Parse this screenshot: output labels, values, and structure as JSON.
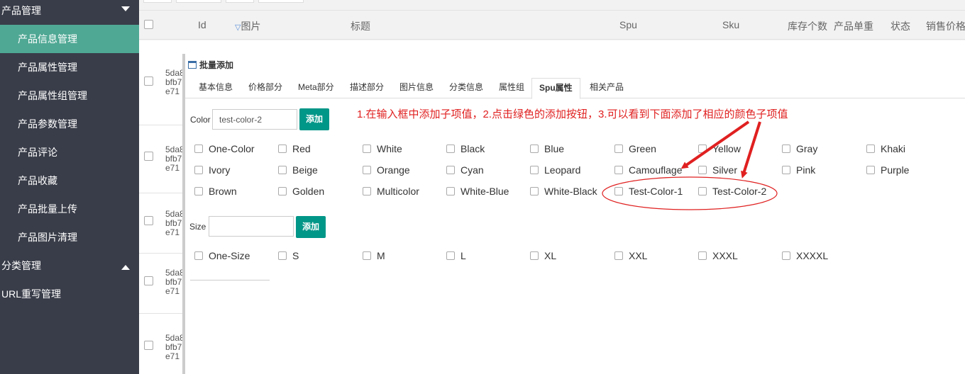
{
  "sidebar": {
    "group_product": "产品管理",
    "items": [
      {
        "label": "产品信息管理",
        "active": true
      },
      {
        "label": "产品属性管理",
        "active": false
      },
      {
        "label": "产品属性组管理",
        "active": false
      },
      {
        "label": "产品参数管理",
        "active": false
      },
      {
        "label": "产品评论",
        "active": false
      },
      {
        "label": "产品收藏",
        "active": false
      },
      {
        "label": "产品批量上传",
        "active": false
      },
      {
        "label": "产品图片清理",
        "active": false
      }
    ],
    "group_category": "分类管理",
    "url_rewrite": "URL重写管理"
  },
  "table": {
    "headers": {
      "id": "Id",
      "image": "图片",
      "title": "标题",
      "spu": "Spu",
      "sku": "Sku",
      "stock": "库存个数",
      "weight": "产品单重",
      "status": "状态",
      "price": "销售价格"
    },
    "row_ids": [
      [
        "5da8",
        "bfb7",
        "e71"
      ],
      [
        "5da8",
        "bfb7",
        "e71"
      ],
      [
        "5da8",
        "bfb7",
        "e71"
      ],
      [
        "5da8",
        "bfb7",
        "e71"
      ],
      [
        "5da8",
        "bfb7",
        "e71"
      ]
    ]
  },
  "modal": {
    "title": "批量添加",
    "tabs": [
      {
        "label": "基本信息",
        "active": false
      },
      {
        "label": "价格部分",
        "active": false
      },
      {
        "label": "Meta部分",
        "active": false
      },
      {
        "label": "描述部分",
        "active": false
      },
      {
        "label": "图片信息",
        "active": false
      },
      {
        "label": "分类信息",
        "active": false
      },
      {
        "label": "属性组",
        "active": false
      },
      {
        "label": "Spu属性",
        "active": true
      },
      {
        "label": "相关产品",
        "active": false
      }
    ],
    "color": {
      "label": "Color",
      "input_value": "test-color-2",
      "add_label": "添加",
      "options": [
        "One-Color",
        "Red",
        "White",
        "Black",
        "Blue",
        "Green",
        "Yellow",
        "Gray",
        "Khaki",
        "Ivory",
        "Beige",
        "Orange",
        "Cyan",
        "Leopard",
        "Camouflage",
        "Silver",
        "Pink",
        "Purple",
        "Brown",
        "Golden",
        "Multicolor",
        "White-Blue",
        "White-Black",
        "Test-Color-1",
        "Test-Color-2"
      ]
    },
    "size": {
      "label": "Size",
      "input_value": "",
      "add_label": "添加",
      "options": [
        "One-Size",
        "S",
        "M",
        "L",
        "XL",
        "XXL",
        "XXXL",
        "XXXXL"
      ]
    },
    "instruction": "1.在输入框中添加子项值，2.点击绿色的添加按钮，3.可以看到下面添加了相应的颜色子项值"
  },
  "colors": {
    "sidebar_bg": "#393d49",
    "sidebar_active": "#4fa894",
    "add_button": "#009688",
    "annotation": "#e02020"
  }
}
